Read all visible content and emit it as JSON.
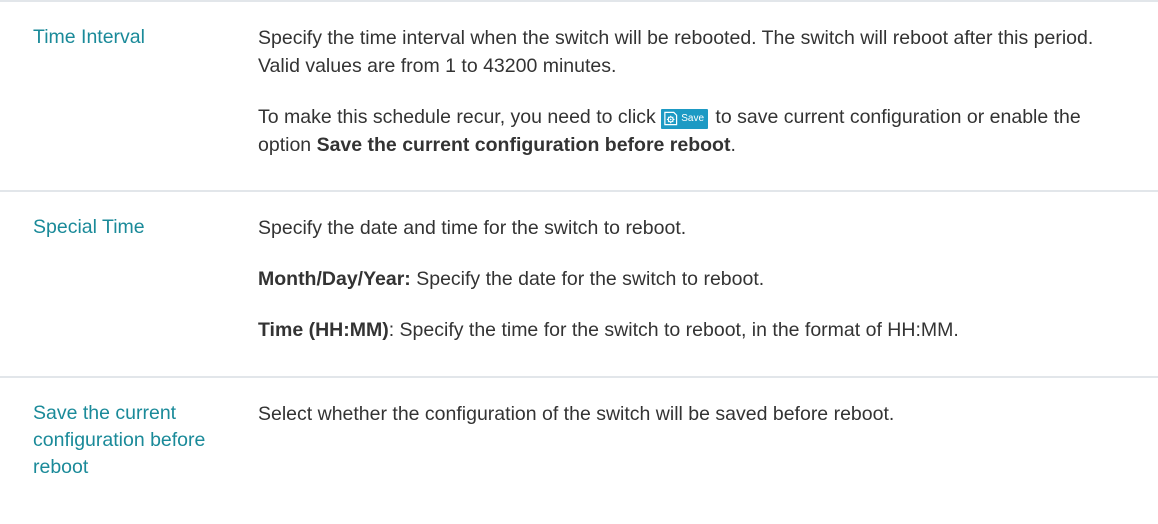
{
  "rows": [
    {
      "name": "Time Interval",
      "line1": "Specify the time interval when the switch will be rebooted. The switch will reboot after this period. Valid values are from 1 to 43200 minutes.",
      "line2_before": "To make this schedule recur, you need to click ",
      "button_label": "Save",
      "line2_after": " to save current configuration or enable the option ",
      "line2_bold": "Save the current configuration before reboot",
      "line2_end": "."
    },
    {
      "name": "Special Time",
      "line1": "Specify the date and time for the switch to reboot.",
      "date_label": "Month/Day/Year:",
      "date_text": " Specify the date for the switch to reboot.",
      "time_label": "Time (HH:MM)",
      "time_text": ": Specify the time for the switch to reboot, in the format of HH:MM."
    },
    {
      "name": "Save the current configuration before reboot",
      "line1": "Select whether the configuration of the switch will be saved before reboot."
    }
  ],
  "icons": {
    "save_button_icon": "save-gear-icon"
  },
  "colors": {
    "parameter_name": "#1a8a99",
    "body_text": "#333333",
    "divider": "#e2e6ea",
    "save_button_bg": "#1d9ac4"
  }
}
